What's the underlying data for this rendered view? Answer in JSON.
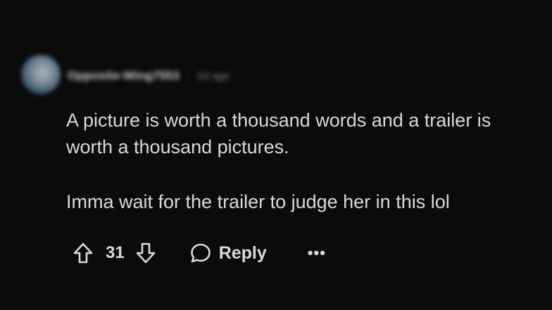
{
  "comment": {
    "author": "Opposite-Wing7553",
    "separator": "·",
    "age": "1d ago",
    "paragraphs": [
      "A picture is worth a thousand words and a trailer is worth a thousand pictures.",
      "Imma wait for the trailer to judge her in this lol"
    ]
  },
  "actions": {
    "upvote_icon": "upvote-arrow-icon",
    "vote_count": "31",
    "downvote_icon": "downvote-arrow-icon",
    "reply_icon": "speech-bubble-icon",
    "reply_label": "Reply",
    "more_label": "•••"
  },
  "colors": {
    "background": "#0b0b0c",
    "text": "#d7dadc",
    "muted": "#7c8287"
  }
}
